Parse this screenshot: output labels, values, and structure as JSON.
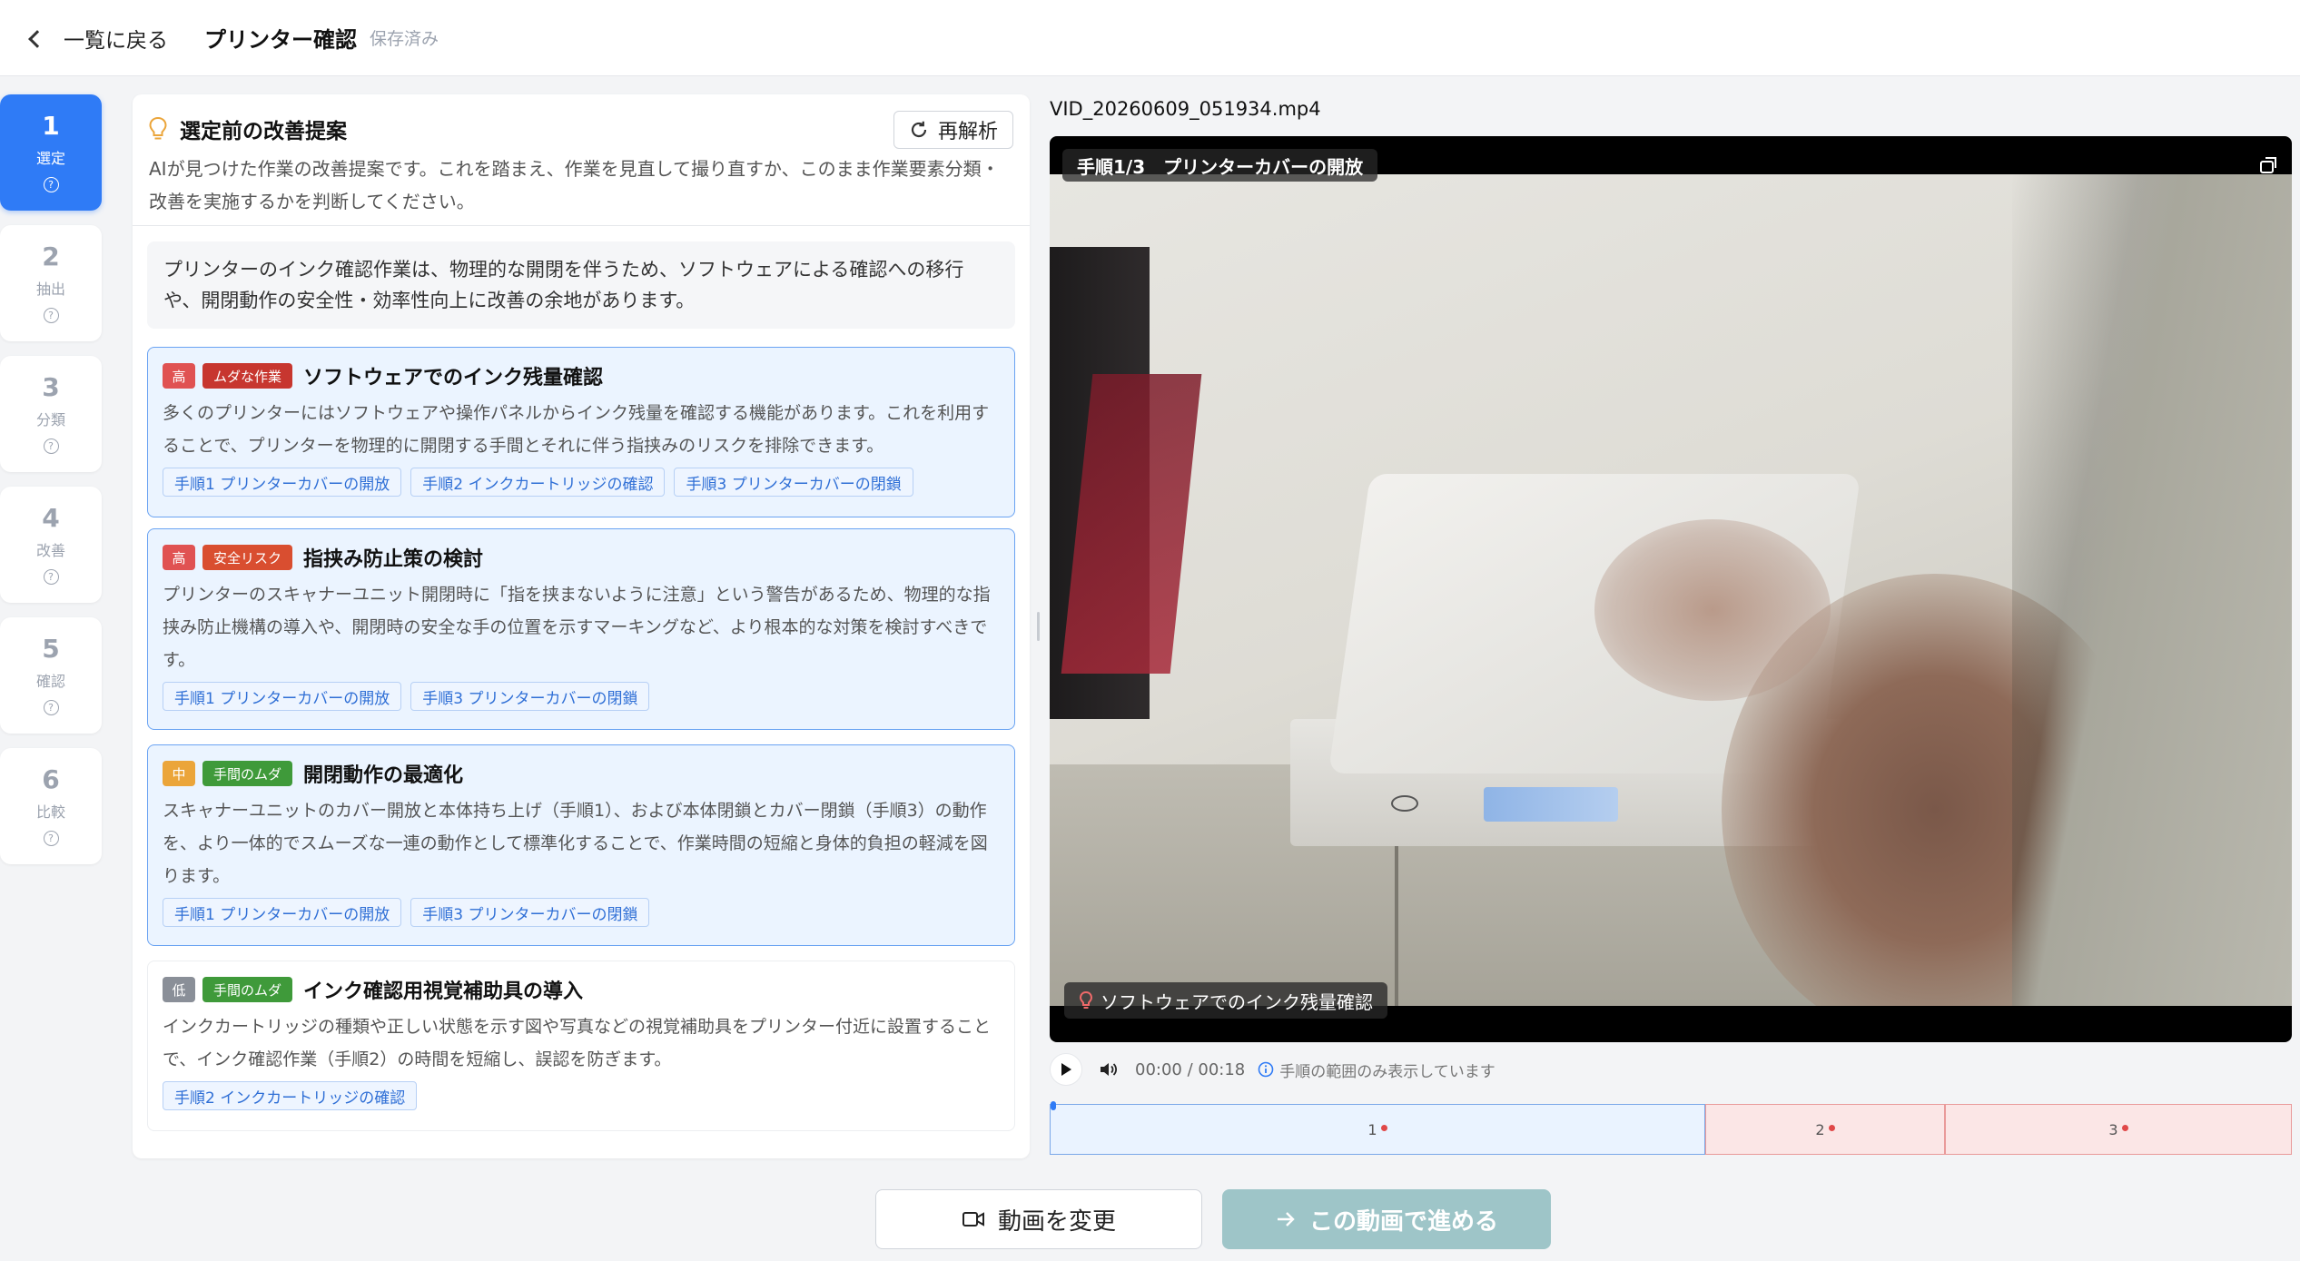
{
  "header": {
    "back_label": "一覧に戻る",
    "title": "プリンター確認",
    "status": "保存済み"
  },
  "steps": [
    {
      "num": "1",
      "label": "選定",
      "help": "?",
      "active": true
    },
    {
      "num": "2",
      "label": "抽出",
      "help": "?"
    },
    {
      "num": "3",
      "label": "分類",
      "help": "?"
    },
    {
      "num": "4",
      "label": "改善",
      "help": "?"
    },
    {
      "num": "5",
      "label": "確認",
      "help": "?"
    },
    {
      "num": "6",
      "label": "比較",
      "help": "?"
    }
  ],
  "panel": {
    "title": "選定前の改善提案",
    "reanalyze_label": "再解析",
    "description": "AIが見つけた作業の改善提案です。これを踏まえ、作業を見直して撮り直すか、このまま作業要素分類・改善を実施するかを判断してください。",
    "summary": "プリンターのインク確認作業は、物理的な開閉を伴うため、ソフトウェアによる確認への移行や、開閉動作の安全性・効率性向上に改善の余地があります。"
  },
  "suggestions": [
    {
      "priority": "高",
      "category": "ムダな作業",
      "title": "ソフトウェアでのインク残量確認",
      "body": "多くのプリンターにはソフトウェアや操作パネルからインク残量を確認する機能があります。これを利用することで、プリンターを物理的に開閉する手間とそれに伴う指挟みのリスクを排除できます。",
      "tags": [
        "手順1 プリンターカバーの開放",
        "手順2 インクカートリッジの確認",
        "手順3 プリンターカバーの閉鎖"
      ]
    },
    {
      "priority": "高",
      "category": "安全リスク",
      "title": "指挟み防止策の検討",
      "body": "プリンターのスキャナーユニット開閉時に「指を挟まないように注意」という警告があるため、物理的な指挟み防止機構の導入や、開閉時の安全な手の位置を示すマーキングなど、より根本的な対策を検討すべきです。",
      "tags": [
        "手順1 プリンターカバーの開放",
        "手順3 プリンターカバーの閉鎖"
      ]
    },
    {
      "priority": "中",
      "category": "手間のムダ",
      "title": "開閉動作の最適化",
      "body": "スキャナーユニットのカバー開放と本体持ち上げ（手順1）、および本体閉鎖とカバー閉鎖（手順3）の動作を、より一体的でスムーズな一連の動作として標準化することで、作業時間の短縮と身体的負担の軽減を図ります。",
      "tags": [
        "手順1 プリンターカバーの開放",
        "手順3 プリンターカバーの閉鎖"
      ]
    },
    {
      "priority": "低",
      "category": "手間のムダ",
      "title": "インク確認用視覚補助具の導入",
      "body": "インクカートリッジの種類や正しい状態を示す図や写真などの視覚補助具をプリンター付近に設置することで、インク確認作業（手順2）の時間を短縮し、誤認を防ぎます。",
      "tags": [
        "手順2 インクカートリッジの確認"
      ]
    }
  ],
  "colors": {
    "priority_high": "#e05252",
    "priority_mid": "#eba53a",
    "priority_low": "#8a8f98",
    "cat_muda": "#c7362f",
    "cat_risk": "#d94e30",
    "cat_tema": "#3f9a3a",
    "accent": "#2f7bf6"
  },
  "video": {
    "filename": "VID_20260609_051934.mp4",
    "step_overlay": "手順1/3　プリンターカバーの開放",
    "suggestion_overlay": "ソフトウェアでのインク残量確認",
    "time": "00:00 / 00:18",
    "range_note": "手順の範囲のみ表示しています",
    "segments": [
      "1",
      "2",
      "3"
    ]
  },
  "footer": {
    "change_label": "動画を変更",
    "proceed_label": "この動画で進める"
  }
}
